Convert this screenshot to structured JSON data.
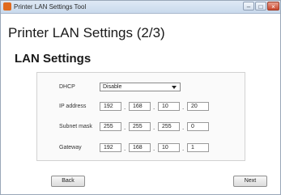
{
  "window": {
    "title": "Printer LAN Settings Tool",
    "minimize_glyph": "–",
    "maximize_glyph": "□",
    "close_glyph": "×"
  },
  "page": {
    "heading": "Printer LAN Settings (2/3)",
    "section_heading": "LAN Settings"
  },
  "form": {
    "dhcp_label": "DHCP",
    "dhcp_value": "Disable",
    "ip_label": "IP address",
    "ip_octets": [
      "192",
      "168",
      "10",
      "20"
    ],
    "subnet_label": "Subnet mask",
    "subnet_octets": [
      "255",
      "255",
      "255",
      "0"
    ],
    "gateway_label": "Gateway",
    "gateway_octets": [
      "192",
      "168",
      "10",
      "1"
    ],
    "separator": "."
  },
  "buttons": {
    "back_label": "Back",
    "next_label": "Next"
  },
  "icons": {
    "app": "printer-app-icon",
    "dropdown": "chevron-down-icon"
  }
}
